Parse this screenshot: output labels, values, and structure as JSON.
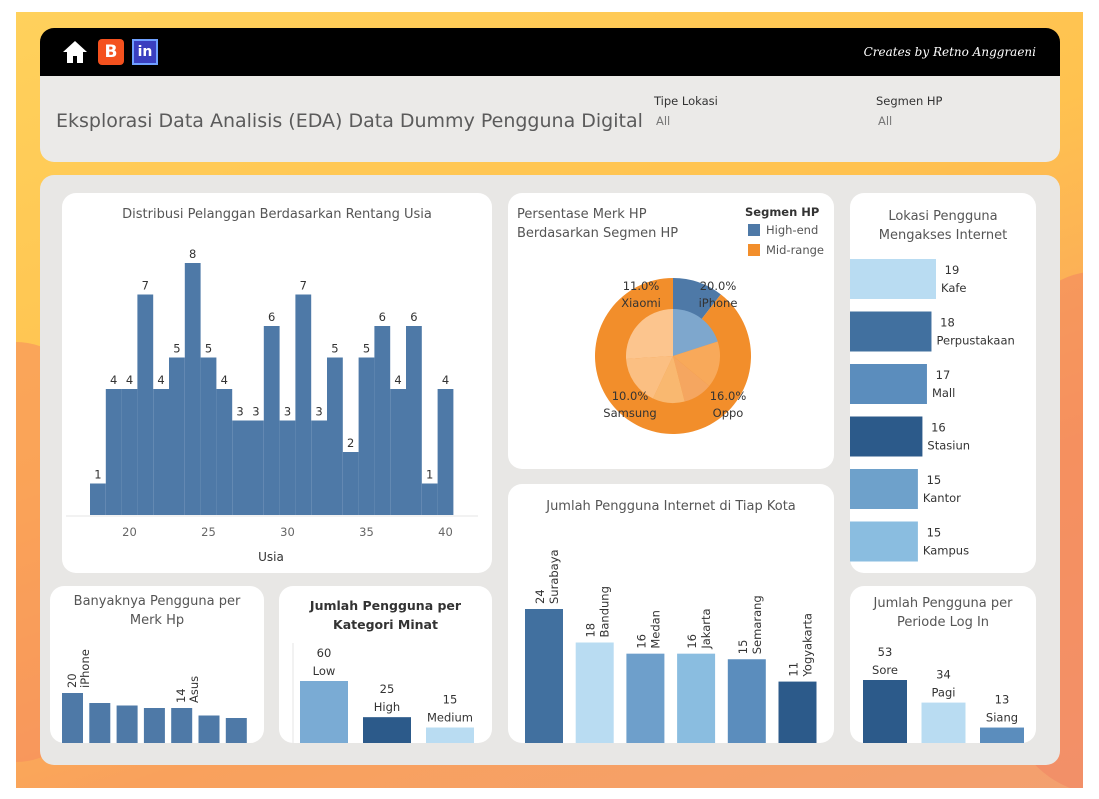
{
  "header": {
    "title": "Eksplorasi Data Analisis (EDA) Data Dummy Pengguna Digital",
    "credit": "Creates by Retno Anggraeni",
    "filters": [
      {
        "label": "Tipe Lokasi",
        "value": "All"
      },
      {
        "label": "Segmen HP",
        "value": "All"
      }
    ],
    "icons": [
      "home-icon",
      "blogger-icon",
      "linkedin-icon"
    ],
    "linkedin_glyph": "in",
    "blogger_glyph": "B"
  },
  "colors": {
    "dark_blue": "#2c5a8a",
    "mid_blue": "#4e79a7",
    "light_blue": "#b9dcf2",
    "sky_blue": "#77a7d0",
    "orange": "#f28e2b",
    "light_orange": "#fbbf80"
  },
  "chart_data": [
    {
      "id": "usia",
      "type": "bar",
      "title": "Distribusi Pelanggan Berdasarkan Rentang Usia",
      "xlabel": "Usia",
      "ylabel": "",
      "x": [
        18,
        19,
        20,
        21,
        22,
        23,
        24,
        25,
        26,
        27,
        28,
        29,
        30,
        31,
        32,
        33,
        34,
        35,
        36,
        37,
        38,
        39,
        40
      ],
      "values": [
        1,
        4,
        4,
        7,
        4,
        5,
        8,
        5,
        4,
        3,
        3,
        6,
        3,
        7,
        3,
        5,
        2,
        5,
        6,
        4,
        6,
        1,
        4
      ],
      "xticks": [
        20,
        25,
        30,
        35,
        40
      ],
      "ylim": [
        0,
        8
      ]
    },
    {
      "id": "merk_segmen",
      "type": "pie",
      "title": "Persentase Merk HP Berdasarkan Segmen HP",
      "legend_title": "Segmen HP",
      "legend": [
        "High-end",
        "Mid-range"
      ],
      "labels": [
        {
          "name": "iPhone",
          "pct": "20.0%"
        },
        {
          "name": "Oppo",
          "pct": "16.0%"
        },
        {
          "name": "Samsung",
          "pct": "10.0%"
        },
        {
          "name": "Xiaomi",
          "pct": "11.0%"
        }
      ]
    },
    {
      "id": "lokasi",
      "type": "bar",
      "title": "Lokasi Pengguna Mengakses Internet",
      "categories": [
        "Kafe",
        "Perpustakaan",
        "Mall",
        "Stasiun",
        "Kantor",
        "Kampus"
      ],
      "values": [
        19,
        18,
        17,
        16,
        15,
        15
      ]
    },
    {
      "id": "merk",
      "type": "bar",
      "title": "Banyaknya Pengguna per Merk Hp",
      "categories": [
        "iPhone",
        "",
        "",
        "",
        "Asus",
        "",
        ""
      ],
      "values": [
        20,
        16,
        15,
        14,
        14,
        11,
        10
      ],
      "value_labels": [
        "20",
        "",
        "",
        "",
        "14",
        "",
        ""
      ]
    },
    {
      "id": "minat",
      "type": "bar",
      "title": "Jumlah Pengguna per Kategori Minat",
      "categories": [
        "Low",
        "High",
        "Medium"
      ],
      "values": [
        60,
        25,
        15
      ]
    },
    {
      "id": "kota",
      "type": "bar",
      "title": "Jumlah Pengguna Internet di Tiap Kota",
      "categories": [
        "Surabaya",
        "Bandung",
        "Medan",
        "Jakarta",
        "Semarang",
        "Yogyakarta"
      ],
      "values": [
        24,
        18,
        16,
        16,
        15,
        11
      ]
    },
    {
      "id": "periode",
      "type": "bar",
      "title": "Jumlah Pengguna per Periode Log In",
      "categories": [
        "Sore",
        "Pagi",
        "Siang"
      ],
      "values": [
        53,
        34,
        13
      ]
    }
  ]
}
